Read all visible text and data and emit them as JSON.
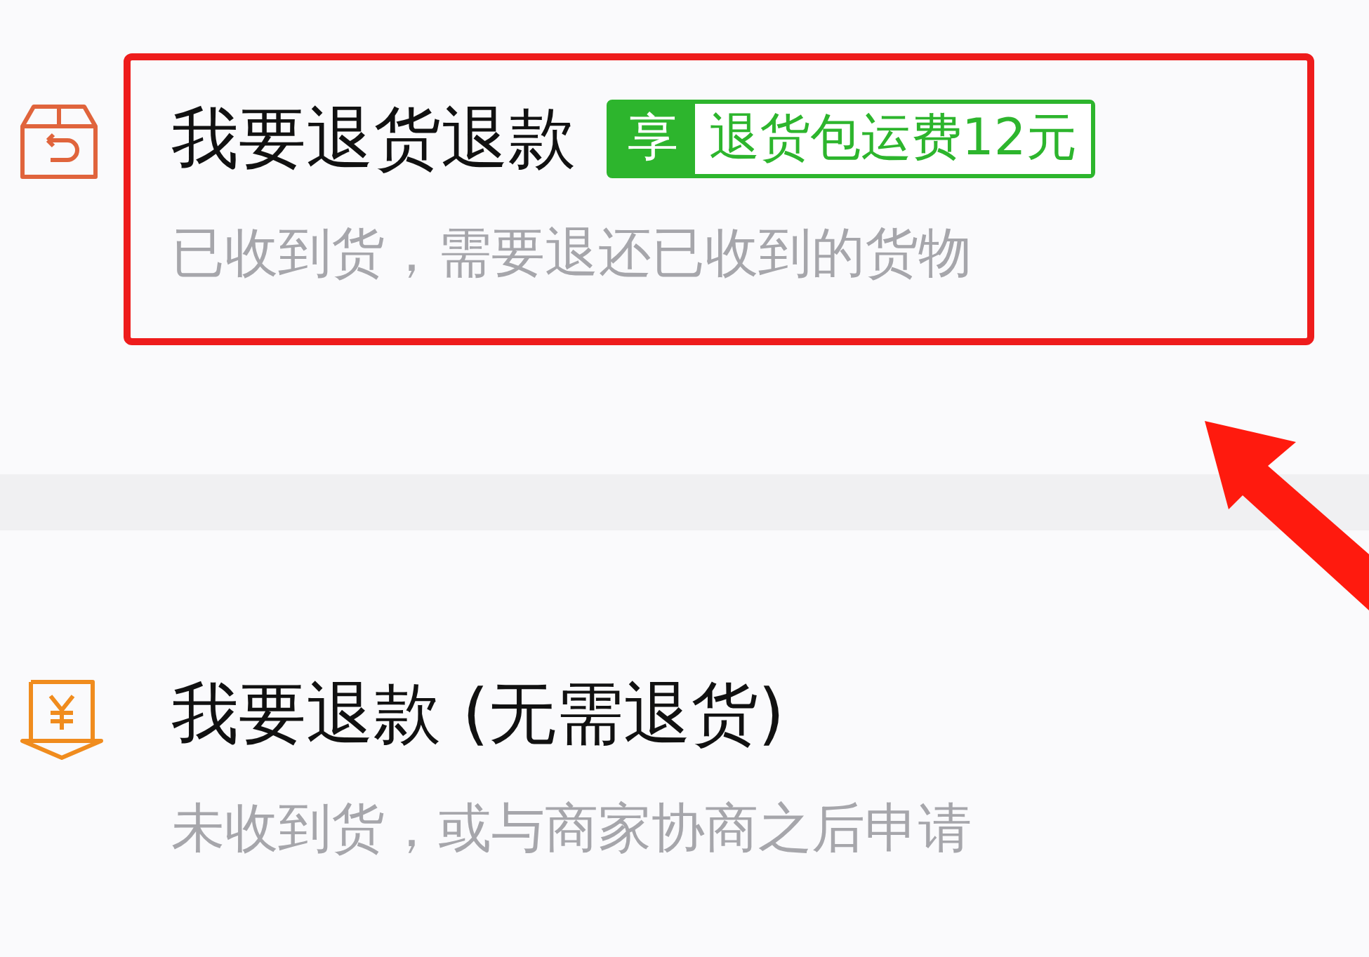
{
  "options": [
    {
      "kind": "return",
      "title": "我要退货退款",
      "badge": {
        "prefix": "享",
        "text": "退货包运费12元"
      },
      "subtitle": "已收到货，需要退还已收到的货物",
      "highlighted": true
    },
    {
      "kind": "refund",
      "title": "我要退款 (无需退货)",
      "subtitle": "未收到货，或与商家协商之后申请",
      "highlighted": false
    }
  ]
}
